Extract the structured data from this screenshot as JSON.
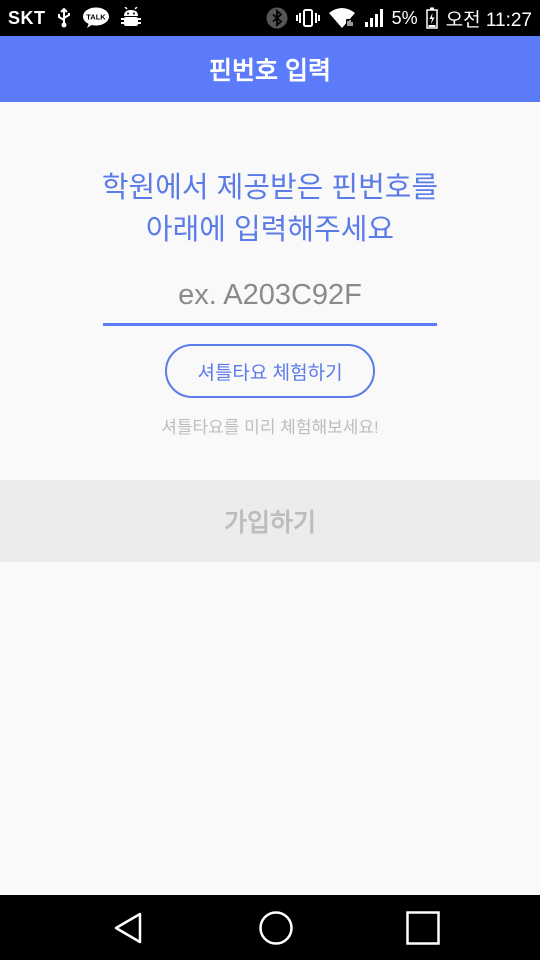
{
  "status_bar": {
    "carrier": "SKT",
    "battery_percent": "5%",
    "time": "오전 11:27",
    "icons": [
      "usb-icon",
      "kakaotalk-icon",
      "android-debug-icon",
      "bluetooth-icon",
      "vibrate-icon",
      "wifi-icon",
      "signal-icon",
      "battery-icon"
    ],
    "talk_badge": "TALK"
  },
  "app_bar": {
    "title": "핀번호 입력",
    "color": "#5b7bfb"
  },
  "main": {
    "instruction_line1": "학원에서 제공받은 핀번호를",
    "instruction_line2": "아래에 입력해주세요",
    "pin_input": {
      "placeholder": "ex. A203C92F",
      "value": ""
    },
    "trial_button_label": "셔틀타요 체험하기",
    "trial_hint": "셔틀타요를 미리 체험해보세요!",
    "signup_button_label": "가입하기"
  },
  "nav_bar": {
    "buttons": [
      "back-icon",
      "home-icon",
      "recents-icon"
    ]
  },
  "colors": {
    "accent": "#5b7bfb",
    "instruction_text": "#5b7be8",
    "disabled_text": "#bdbdbd",
    "disabled_bg": "#ececec"
  }
}
